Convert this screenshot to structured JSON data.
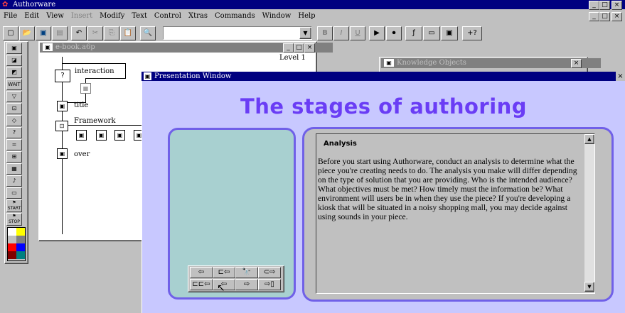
{
  "app": {
    "title": "Authorware",
    "menu": [
      "File",
      "Edit",
      "View",
      "Insert",
      "Modify",
      "Text",
      "Control",
      "Xtras",
      "Commands",
      "Window",
      "Help"
    ],
    "toolbar": {
      "bold": "B",
      "italic": "I",
      "underline": "U",
      "help": "+?"
    }
  },
  "icon_palette": {
    "tools": [
      "display-icon",
      "motion-icon",
      "erase-icon",
      "wait-icon",
      "navigate-icon",
      "framework-icon",
      "decision-icon",
      "interaction-icon",
      "calculation-icon",
      "map-icon",
      "digital-movie-icon",
      "sound-icon",
      "video-icon"
    ],
    "start_label": "START",
    "stop_label": "STOP",
    "colors": [
      "#ffffff",
      "#ffff00",
      "#c0c0c0",
      "#808080",
      "#ff0000",
      "#0000ff",
      "#800000",
      "#008080",
      "#ff00ff",
      "#00ff00",
      "#000080",
      "#808000",
      "#008000",
      "#800080",
      "#00ffff",
      "#000000"
    ]
  },
  "flowline": {
    "title": "e-book.a6p",
    "level": "Level 1",
    "icons": {
      "interaction": "interaction",
      "title": "title",
      "framework": "Framework",
      "over": "over"
    }
  },
  "knowledge_objects": {
    "title": "Knowledge Objects"
  },
  "presentation": {
    "window_title": "Presentation Window",
    "heading": "The stages of authoring",
    "section_title": "Analysis",
    "body": "Before you start using Authorware, conduct an analysis to determine what the piece you're creating needs to do. The analysis you make will differ depending on the type of solution that you are providing. Who is the intended audience? What objectives must be met? How timely must the information be? What environment will users be in when they use the piece? If you're developing a kiosk that will be situated in a noisy shopping mall, you may decide against using sounds in your piece.",
    "colors": {
      "background": "#c8c8ff",
      "heading": "#6a3df5",
      "left_panel": "#a8d0d0",
      "right_panel": "#c0c0c0",
      "panel_border": "#7060e8"
    },
    "nav_buttons_row1": [
      "⇦",
      "⊏⇦",
      "🔭",
      "⊂⇨"
    ],
    "nav_buttons_row2": [
      "⊏⊏⇦",
      "⇦",
      "⇨",
      "⇨▯"
    ]
  }
}
